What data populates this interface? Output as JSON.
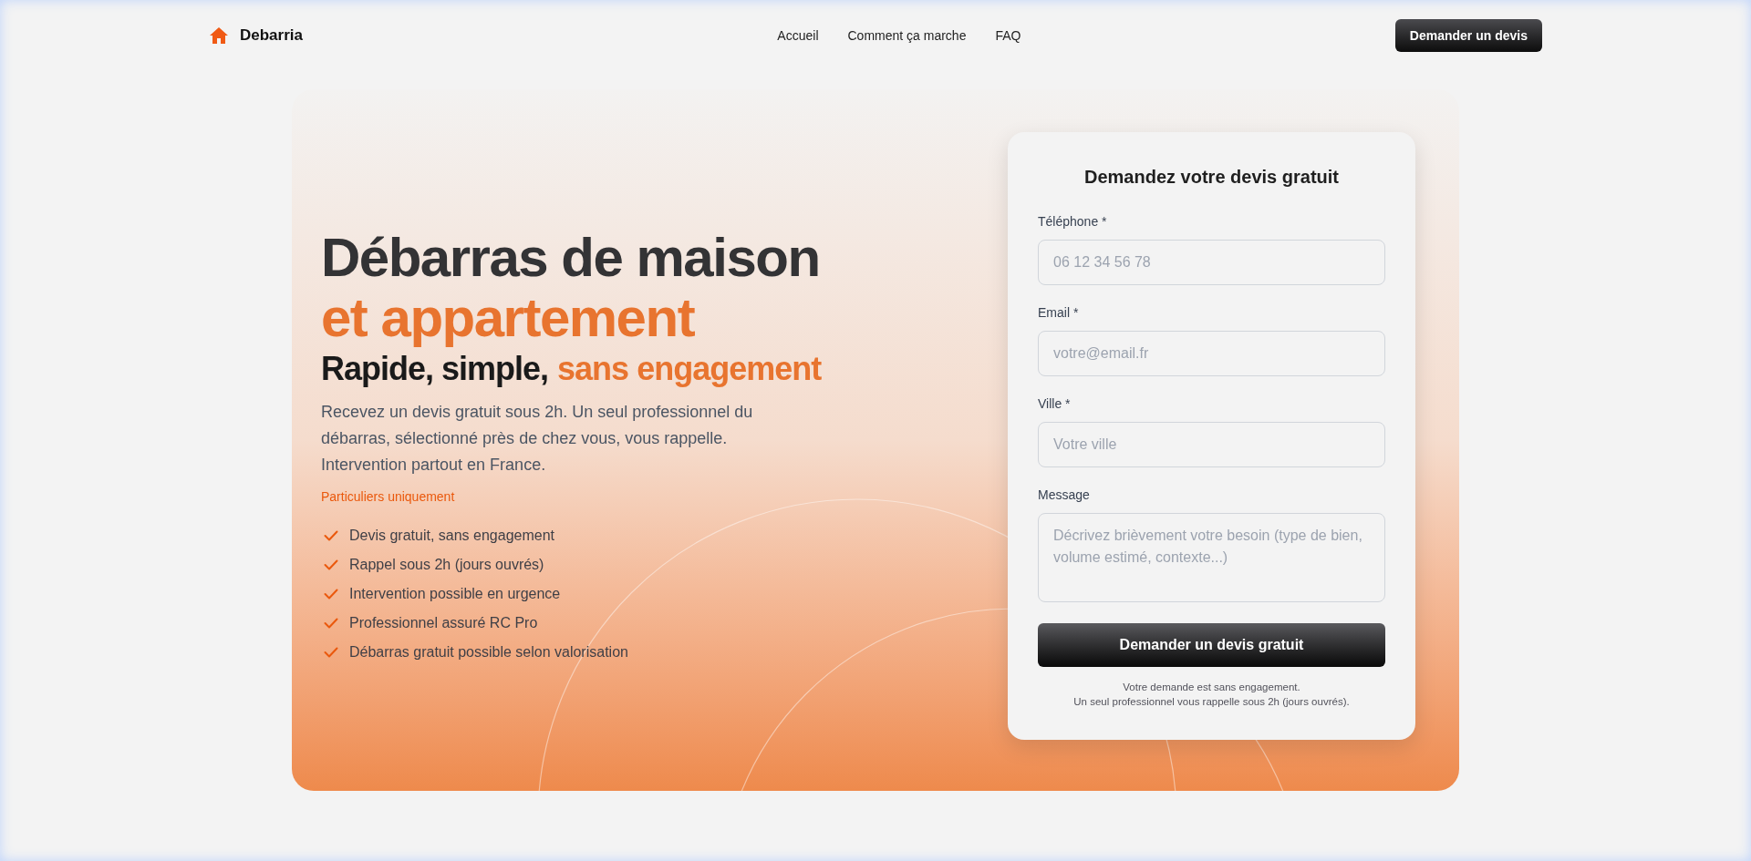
{
  "header": {
    "brand": "Debarria",
    "nav": [
      {
        "label": "Accueil"
      },
      {
        "label": "Comment ça marche"
      },
      {
        "label": "FAQ"
      }
    ],
    "cta": "Demander un devis"
  },
  "hero": {
    "title": "Débarras de maison",
    "title_accent": "et appartement",
    "subtitle": {
      "lead": "Rapide, simple,",
      "accent": "sans engagement"
    },
    "description": "Recevez un devis gratuit sous 2h. Un seul professionnel du débarras, sélectionné près de chez vous, vous rappelle. Intervention partout en France.",
    "note": "Particuliers uniquement",
    "benefits": [
      "Devis gratuit, sans engagement",
      "Rappel sous 2h (jours ouvrés)",
      "Intervention possible en urgence",
      "Professionnel assuré RC Pro",
      "Débarras gratuit possible selon valorisation"
    ]
  },
  "form": {
    "title": "Demandez votre devis gratuit",
    "fields": [
      {
        "kind": "input",
        "label": "Téléphone *",
        "placeholder": "06 12 34 56 78"
      },
      {
        "kind": "input",
        "label": "Email *",
        "placeholder": "votre@email.fr"
      },
      {
        "kind": "input",
        "label": "Ville *",
        "placeholder": "Votre ville"
      },
      {
        "kind": "textarea",
        "label": "Message",
        "placeholder": "Décrivez brièvement votre besoin (type de bien, volume estimé, contexte...)"
      }
    ],
    "submit": "Demander un devis gratuit",
    "disclaimer": [
      "Votre demande est sans engagement.",
      "Un seul professionnel vous rappelle sous 2h (jours ouvrés)."
    ]
  }
}
